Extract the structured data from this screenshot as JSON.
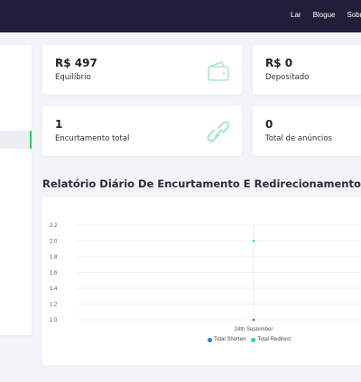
{
  "topnav": {
    "items": [
      "Lar",
      "Blogue",
      "Sobre"
    ]
  },
  "stats": {
    "balance": {
      "value": "R$ 497",
      "label": "Equilíbrio",
      "icon": "wallet-icon"
    },
    "deposited": {
      "value": "R$ 0",
      "label": "Depositado"
    },
    "total_shorten": {
      "value": "1",
      "label": "Encurtamento total",
      "icon": "link-icon"
    },
    "total_ads": {
      "value": "0",
      "label": "Total de anúncios"
    }
  },
  "report": {
    "title": "Relatório Diário De Encurtamento E Redirecionamento"
  },
  "colors": {
    "accent": "#2ecc71",
    "icon": "#a8e6c3",
    "topbar": "#1f1f3a",
    "series_shorten": "#1e88e5",
    "series_redirect": "#2ed3a0"
  },
  "chart_data": {
    "type": "line",
    "categories": [
      "24th September"
    ],
    "series": [
      {
        "name": "Total Shorten",
        "values": [
          1
        ]
      },
      {
        "name": "Total Redirect",
        "values": [
          2
        ]
      }
    ],
    "yticks": [
      "2.2",
      "2.0",
      "1.8",
      "1.6",
      "1.4",
      "1.2",
      "1.0"
    ],
    "ylim": [
      1.0,
      2.2
    ],
    "grid": true,
    "legend": "bottom"
  }
}
